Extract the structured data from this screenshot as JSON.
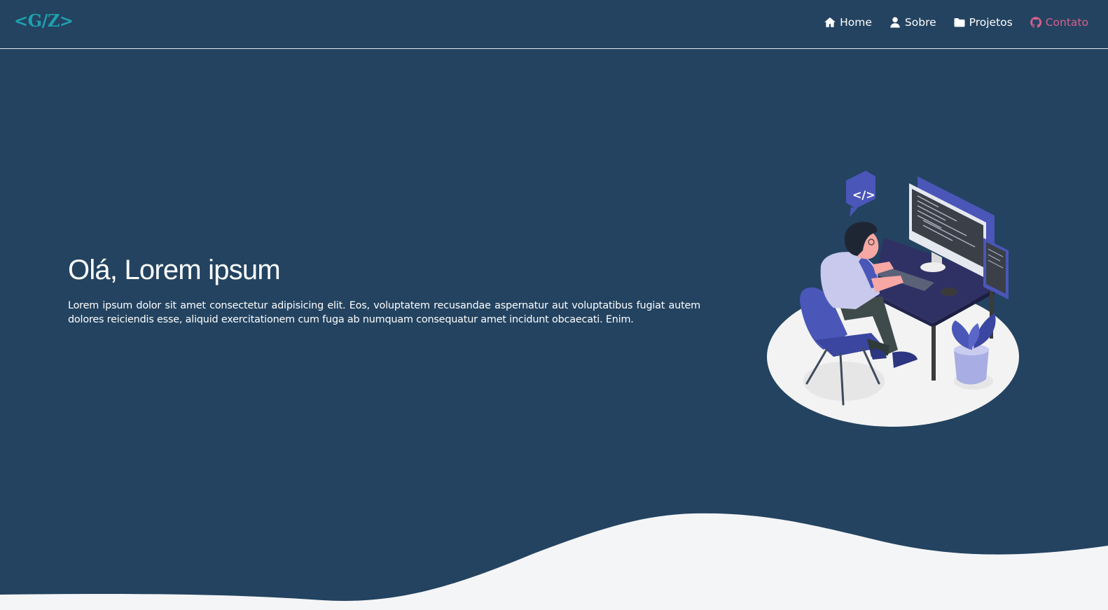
{
  "brand": {
    "logo_text": "<G/Z>",
    "accent_color": "#1fa0ae"
  },
  "nav": {
    "items": [
      {
        "label": "Home",
        "icon": "home-icon"
      },
      {
        "label": "Sobre",
        "icon": "user-icon"
      },
      {
        "label": "Projetos",
        "icon": "folder-icon"
      },
      {
        "label": "Contato",
        "icon": "github-icon",
        "active": true
      }
    ],
    "active_color": "#d9608d"
  },
  "hero": {
    "title": "Olá, Lorem ipsum",
    "description": "Lorem ipsum dolor sit amet consectetur adipisicing elit. Eos, voluptatem recusandae aspernatur aut voluptatibus fugiat autem dolores reiciendis esse, aliquid exercitationem cum fuga ab numquam consequatur amet incidunt obcaecati. Enim.",
    "illustration": "developer-at-desk-illustration",
    "code_badge": "</>"
  },
  "theme": {
    "background": "#234360",
    "wave_color": "#f4f5f7"
  }
}
